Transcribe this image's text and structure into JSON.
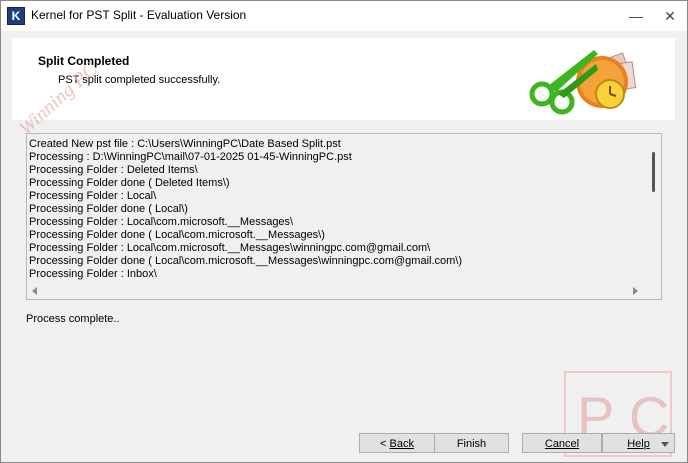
{
  "window": {
    "title": "Kernel for PST Split - Evaluation Version",
    "icon_letter": "K",
    "minimize_glyph": "—",
    "close_glyph": "✕"
  },
  "header": {
    "title": "Split Completed",
    "subtitle": "PST split completed successfully."
  },
  "log": {
    "lines": [
      "Created New pst file : C:\\Users\\WinningPC\\Date Based Split.pst",
      "Processing : D:\\WinningPC\\mail\\07-01-2025 01-45-WinningPC.pst",
      "Processing Folder : Deleted Items\\",
      "Processing Folder done ( Deleted Items\\)",
      "Processing Folder : Local\\",
      "Processing Folder done ( Local\\)",
      "Processing Folder : Local\\com.microsoft.__Messages\\",
      "Processing Folder done ( Local\\com.microsoft.__Messages\\)",
      "Processing Folder : Local\\com.microsoft.__Messages\\winningpc.com@gmail.com\\",
      "Processing Folder done ( Local\\com.microsoft.__Messages\\winningpc.com@gmail.com\\)",
      "Processing Folder : Inbox\\"
    ]
  },
  "status": {
    "text": "Process complete.."
  },
  "buttons": {
    "back": "Back",
    "back_prefix": "< ",
    "finish": "Finish",
    "cancel": "Cancel",
    "help": "Help"
  },
  "watermark": {
    "vertical": "Winning PC",
    "pc_letters": "P C"
  },
  "colors": {
    "scissors_green": "#3cb520",
    "clock_orange": "#e8801c",
    "watermark_red": "#c84040"
  },
  "icons": {
    "header_graphic": "scissors-clock-icon",
    "app": "kernel-app-icon"
  }
}
